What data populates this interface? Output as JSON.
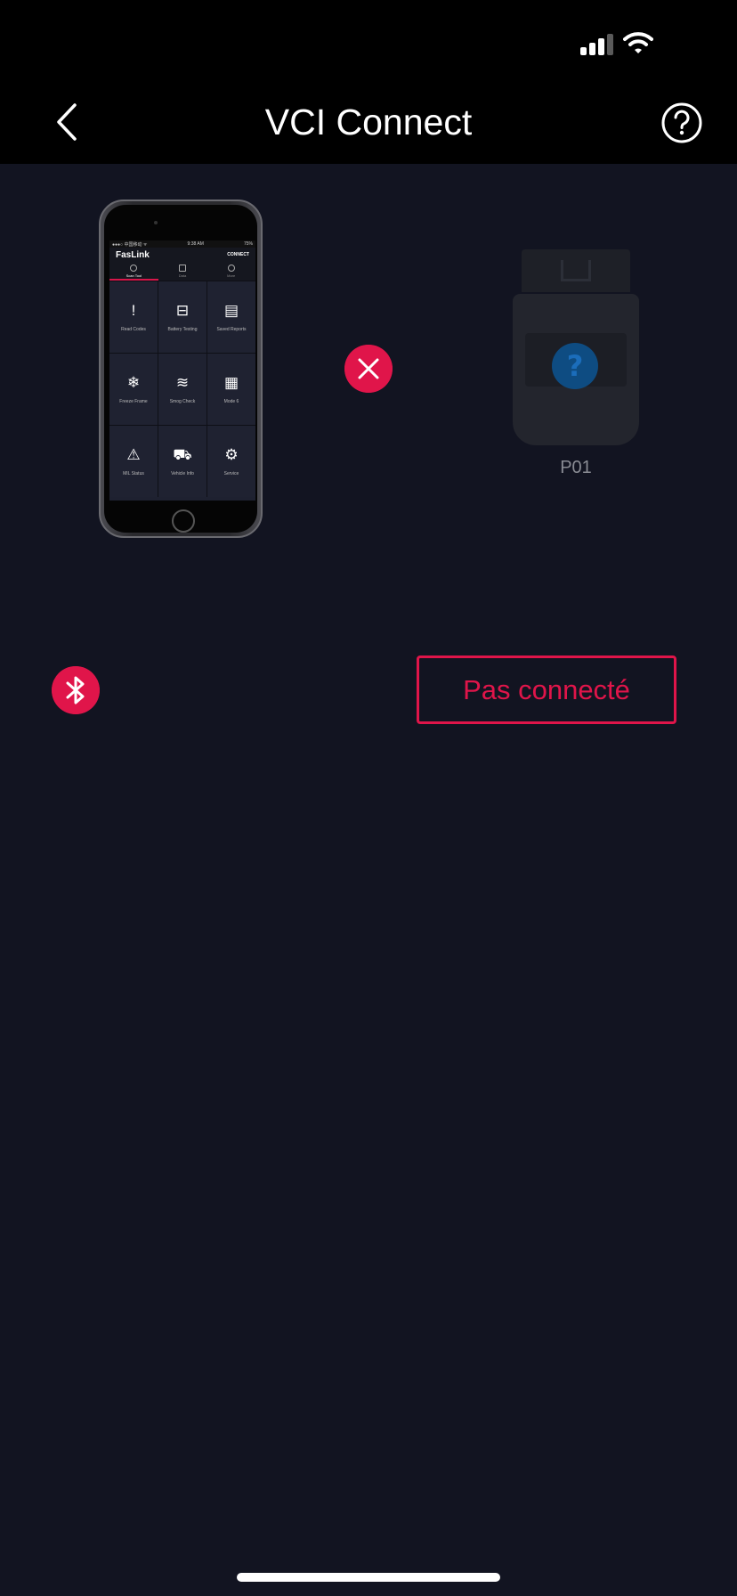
{
  "nav": {
    "title": "VCI Connect"
  },
  "phone_screen": {
    "status_left": "●●●○ 中国移动 ᯤ",
    "status_time": "9:38 AM",
    "status_right": "75%",
    "app_title": "FasLink",
    "connect_label": "CONNECT",
    "tabs": [
      {
        "label": "Scan Tool"
      },
      {
        "label": "Data"
      },
      {
        "label": "More"
      }
    ],
    "cells": [
      {
        "icon": "!",
        "label": "Read Codes"
      },
      {
        "icon": "⊟",
        "label": "Battery Testing"
      },
      {
        "icon": "▤",
        "label": "Saved Reports"
      },
      {
        "icon": "❄",
        "label": "Freeze Frame"
      },
      {
        "icon": "≋",
        "label": "Smog Check"
      },
      {
        "icon": "▦",
        "label": "Mode 6"
      },
      {
        "icon": "⚠",
        "label": "MIL Status"
      },
      {
        "icon": "⛟",
        "label": "Vehicle Info"
      },
      {
        "icon": "⚙",
        "label": "Service"
      }
    ]
  },
  "device": {
    "label": "P01"
  },
  "connection": {
    "status_label": "Pas connecté"
  },
  "colors": {
    "accent": "#e0154a",
    "background": "#121421",
    "header": "#000000"
  }
}
